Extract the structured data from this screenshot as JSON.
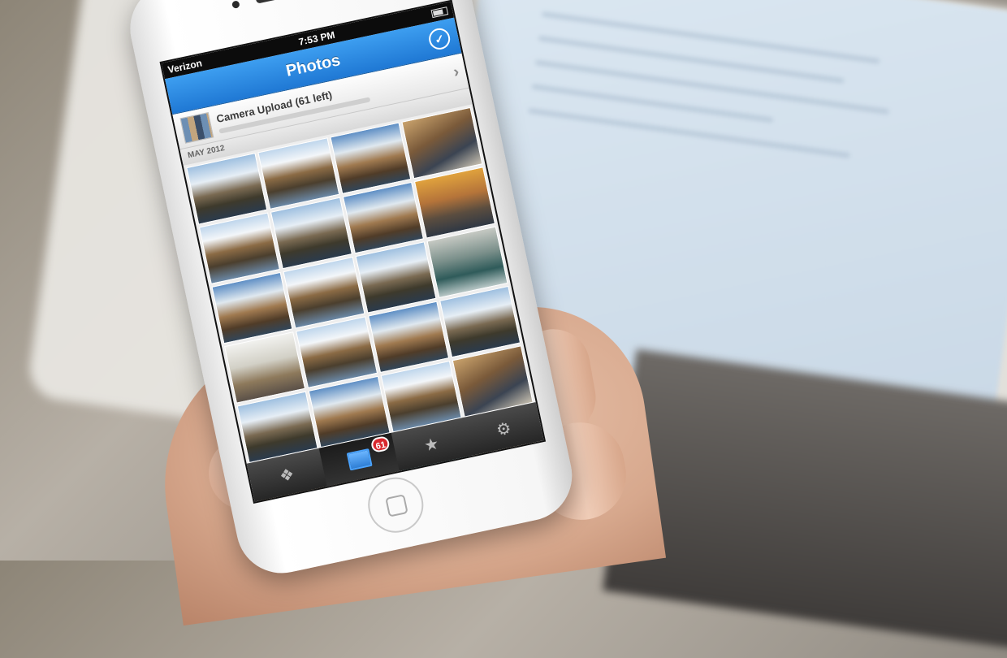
{
  "status_bar": {
    "carrier": "Verizon",
    "time": "7:53 PM"
  },
  "nav": {
    "title": "Photos",
    "done_icon": "checkmark-circle-icon"
  },
  "upload": {
    "label": "Camera Upload (61 left)",
    "progress": 0.0,
    "chevron_icon": "chevron-right-icon"
  },
  "section": {
    "header": "MAY 2012"
  },
  "photos": {
    "count": 28
  },
  "tabbar": {
    "tabs": [
      {
        "icon": "dropbox-icon",
        "active": false
      },
      {
        "icon": "photos-icon",
        "active": true,
        "badge": "61"
      },
      {
        "icon": "star-icon",
        "active": false
      },
      {
        "icon": "gear-icon",
        "active": false
      }
    ]
  },
  "colors": {
    "nav_blue": "#2b89e3",
    "badge_red": "#d9282e"
  }
}
